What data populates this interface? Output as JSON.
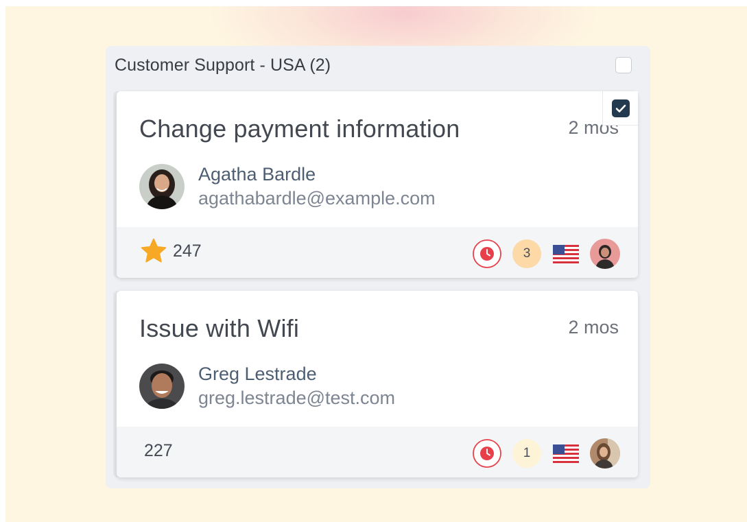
{
  "group": {
    "title": "Customer Support - USA (2)",
    "select_all_checked": false
  },
  "tickets": [
    {
      "title": "Change payment information",
      "time": "2 mos",
      "selected": true,
      "contact": {
        "name": "Agatha Bardle",
        "email": "agathabardle@example.com"
      },
      "starred": true,
      "score": "247",
      "sla_icon": "clock-icon",
      "count": "3",
      "count_color": "#fcd9a6",
      "flag": "us-flag-icon",
      "assignee_icon": "agent-avatar"
    },
    {
      "title": "Issue with Wifi",
      "time": "2 mos",
      "selected": false,
      "contact": {
        "name": "Greg Lestrade",
        "email": "greg.lestrade@test.com"
      },
      "starred": false,
      "score": "227",
      "sla_icon": "clock-icon",
      "count": "1",
      "count_color": "#fdf3d6",
      "flag": "us-flag-icon",
      "assignee_icon": "agent-avatar"
    }
  ],
  "colors": {
    "background": "#fef6e1",
    "group_panel": "#eef0f3",
    "checkbox_checked": "#233a4f",
    "sla_red": "#e8404a",
    "star": "#f7a825"
  }
}
